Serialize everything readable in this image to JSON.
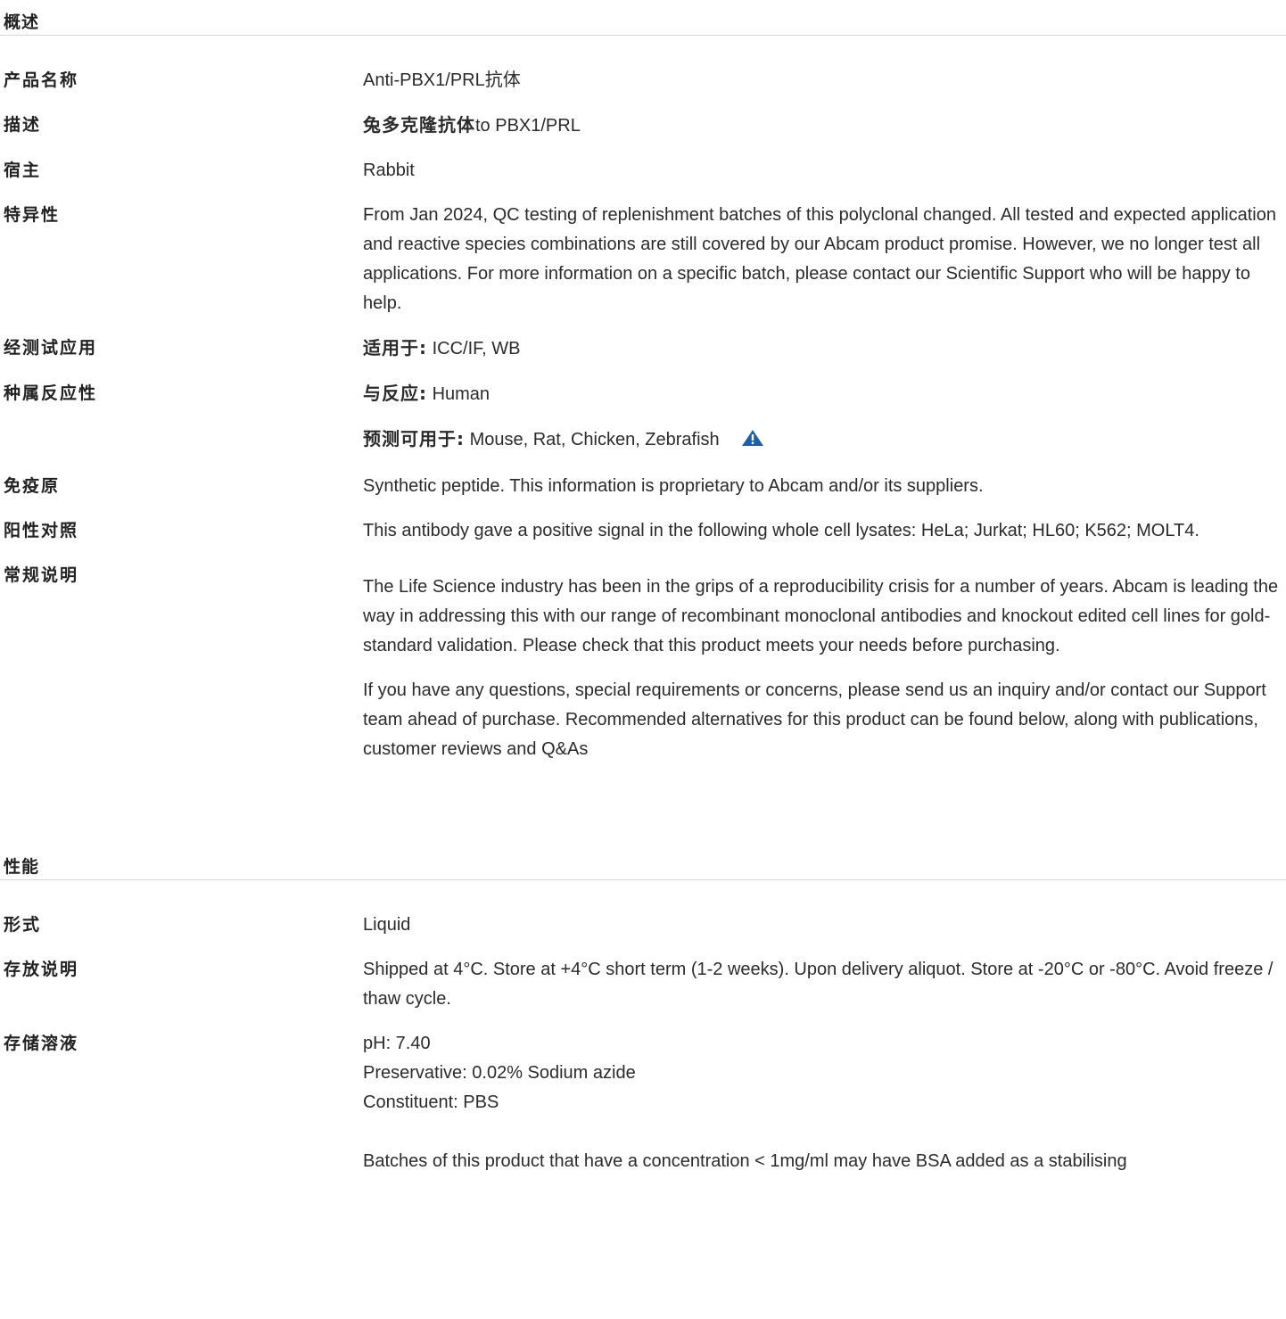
{
  "overview": {
    "title": "概述",
    "rows": {
      "product_name": {
        "label": "产品名称",
        "value": "Anti-PBX1/PRL抗体"
      },
      "description": {
        "label": "描述",
        "value_bold": "兔多克隆抗体",
        "value_rest": "to PBX1/PRL"
      },
      "host": {
        "label": "宿主",
        "value": "Rabbit"
      },
      "specificity": {
        "label": "特异性",
        "value": "From Jan 2024, QC testing of replenishment batches of this polyclonal changed. All tested and expected application and reactive species combinations are still covered by our Abcam product promise. However, we no longer test all applications. For more information on a specific batch, please contact our Scientific Support who will be happy to help."
      },
      "tested_applications": {
        "label": "经测试应用",
        "prefix": "适用于:",
        "value": "ICC/IF, WB"
      },
      "species_reactivity": {
        "label": "种属反应性",
        "prefix": "与反应:",
        "value": "Human",
        "predicted_prefix": "预测可用于:",
        "predicted_value": "Mouse, Rat, Chicken, Zebrafish",
        "warning_icon": "warning-triangle-icon"
      },
      "immunogen": {
        "label": "免疫原",
        "value": "Synthetic peptide. This information is proprietary to Abcam and/or its suppliers."
      },
      "positive_control": {
        "label": "阳性对照",
        "value": "This antibody gave a positive signal in the following whole cell lysates: HeLa; Jurkat; HL60; K562; MOLT4."
      },
      "general_notes": {
        "label": "常规说明",
        "paragraph1": "The Life Science industry has been in the grips of a reproducibility crisis for a number of years. Abcam is leading the way in addressing this with our range of recombinant monoclonal antibodies and knockout edited cell lines for gold-standard validation. Please check that this product meets your needs before purchasing.",
        "paragraph2": "If you have any questions, special requirements or concerns, please send us an inquiry and/or contact our Support team ahead of purchase. Recommended alternatives for this product can be found below, along with publications, customer reviews and Q&As"
      }
    }
  },
  "properties": {
    "title": "性能",
    "rows": {
      "form": {
        "label": "形式",
        "value": "Liquid"
      },
      "storage_instructions": {
        "label": "存放说明",
        "value": "Shipped at 4°C. Store at +4°C short term (1-2 weeks). Upon delivery aliquot. Store at -20°C or -80°C. Avoid freeze / thaw cycle."
      },
      "storage_buffer": {
        "label": "存储溶液",
        "line1": "pH: 7.40",
        "line2": "Preservative: 0.02% Sodium azide",
        "line3": "Constituent: PBS",
        "note": "Batches of this product that have a concentration < 1mg/ml may have BSA added as a stabilising"
      }
    }
  },
  "colors": {
    "warning_icon": "#1f5fa8",
    "divider": "#d6d6d6"
  }
}
